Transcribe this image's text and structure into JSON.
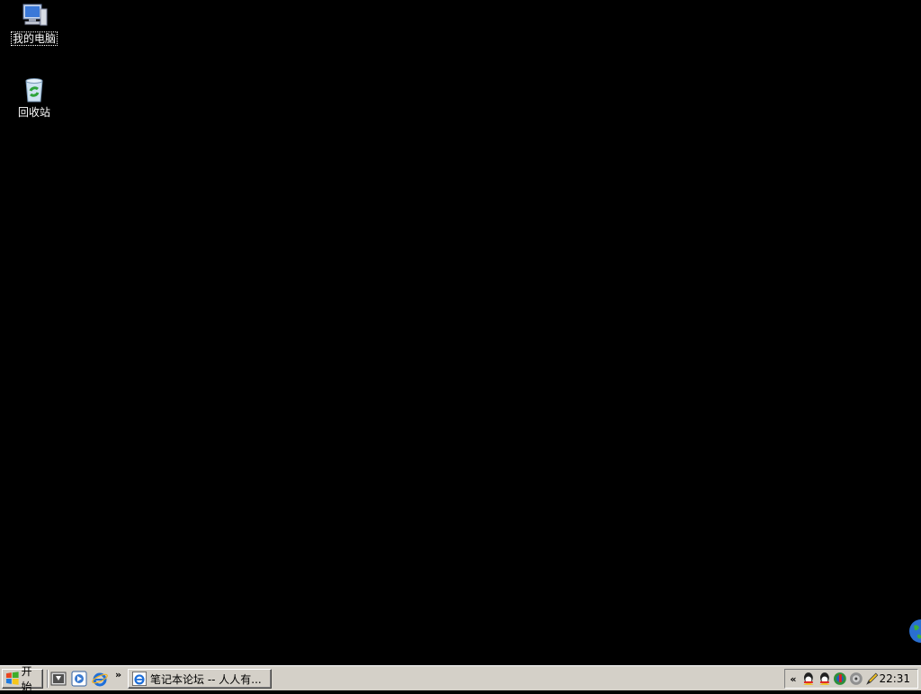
{
  "desktop": {
    "background_color": "#000000",
    "icons": [
      {
        "name": "my-computer",
        "label": "我的电脑",
        "selected": true
      },
      {
        "name": "recycle-bin",
        "label": "回收站",
        "selected": false
      }
    ]
  },
  "taskbar": {
    "start_label": "开始",
    "quick_launch": [
      "show-desktop-icon",
      "media-player-icon",
      "internet-explorer-icon"
    ],
    "quick_launch_more": "»",
    "tasks": [
      {
        "label": "笔记本论坛 -- 人人有...",
        "icon": "internet-explorer-icon"
      }
    ],
    "tray": {
      "expand": "«",
      "icons": [
        "qq-icon",
        "qq-icon",
        "security-icon",
        "volume-icon",
        "pen-icon"
      ],
      "clock": "22:31"
    }
  }
}
